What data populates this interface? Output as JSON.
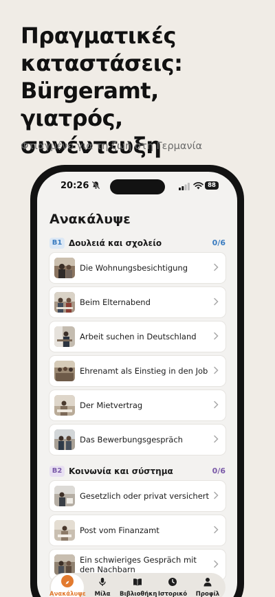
{
  "headline": "Πραγματικές καταστάσεις: Bürgeramt, γιατρός, συνέντευξη",
  "subheadline": "Φτιαγμένο για τη ζωή στη Γερμανία",
  "status_bar": {
    "time": "20:26",
    "battery": "88"
  },
  "page_title": "Ανακάλυψε",
  "colors": {
    "accent": "#e27a2f",
    "b1": "#3a7cc0",
    "b2": "#7a5aa8"
  },
  "sections": [
    {
      "level": "B1",
      "title": "Δουλειά και σχολείο",
      "count": "0/6",
      "items": [
        {
          "title": "Die Wohnungsbesichtigung"
        },
        {
          "title": "Beim Elternabend"
        },
        {
          "title": "Arbeit suchen in Deutschland"
        },
        {
          "title": "Ehrenamt als Einstieg in den Job"
        },
        {
          "title": "Der Mietvertrag"
        },
        {
          "title": "Das Bewerbungsgespräch"
        }
      ]
    },
    {
      "level": "B2",
      "title": "Κοινωνία και σύστημα",
      "count": "0/6",
      "items": [
        {
          "title": "Gesetzlich oder privat versichert"
        },
        {
          "title": "Post vom Finanzamt"
        },
        {
          "title": "Ein schwieriges Gespräch mit den Nachbarn"
        }
      ]
    }
  ],
  "tabs": [
    {
      "label": "Ανακάλυψε",
      "icon": "compass-icon",
      "active": true
    },
    {
      "label": "Μίλα",
      "icon": "microphone-icon",
      "active": false
    },
    {
      "label": "Βιβλιοθήκη",
      "icon": "book-icon",
      "active": false
    },
    {
      "label": "Ιστορικό",
      "icon": "clock-icon",
      "active": false
    },
    {
      "label": "Προφίλ",
      "icon": "person-icon",
      "active": false
    }
  ]
}
